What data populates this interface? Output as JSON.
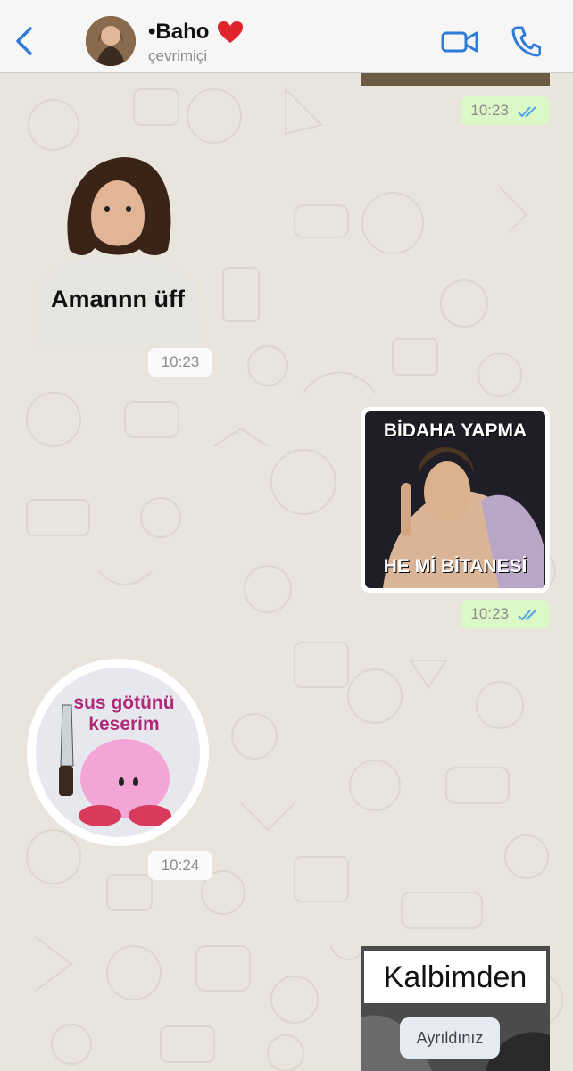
{
  "header": {
    "contact_name": "•Baho",
    "status": "çevrimiçi"
  },
  "messages": [
    {
      "type": "sticker-partial",
      "direction": "outgoing",
      "time": "10:23",
      "read": true
    },
    {
      "type": "sticker",
      "direction": "incoming",
      "caption": "Amannn üff",
      "time": "10:23"
    },
    {
      "type": "sticker",
      "direction": "outgoing",
      "caption_top": "BİDAHA YAPMA",
      "caption_bottom": "HE Mİ BİTANESİ",
      "time": "10:23",
      "read": true
    },
    {
      "type": "sticker",
      "direction": "incoming",
      "caption": "sus götünü keserim",
      "time": "10:24"
    },
    {
      "type": "sticker",
      "direction": "outgoing",
      "caption_top": "Kalbimden",
      "caption_bottom": "Ayrıldınız"
    }
  ],
  "colors": {
    "accent": "#2f7bd9",
    "outgoing_bubble": "#dcf8c6",
    "read_ticks": "#4fa6e8"
  }
}
